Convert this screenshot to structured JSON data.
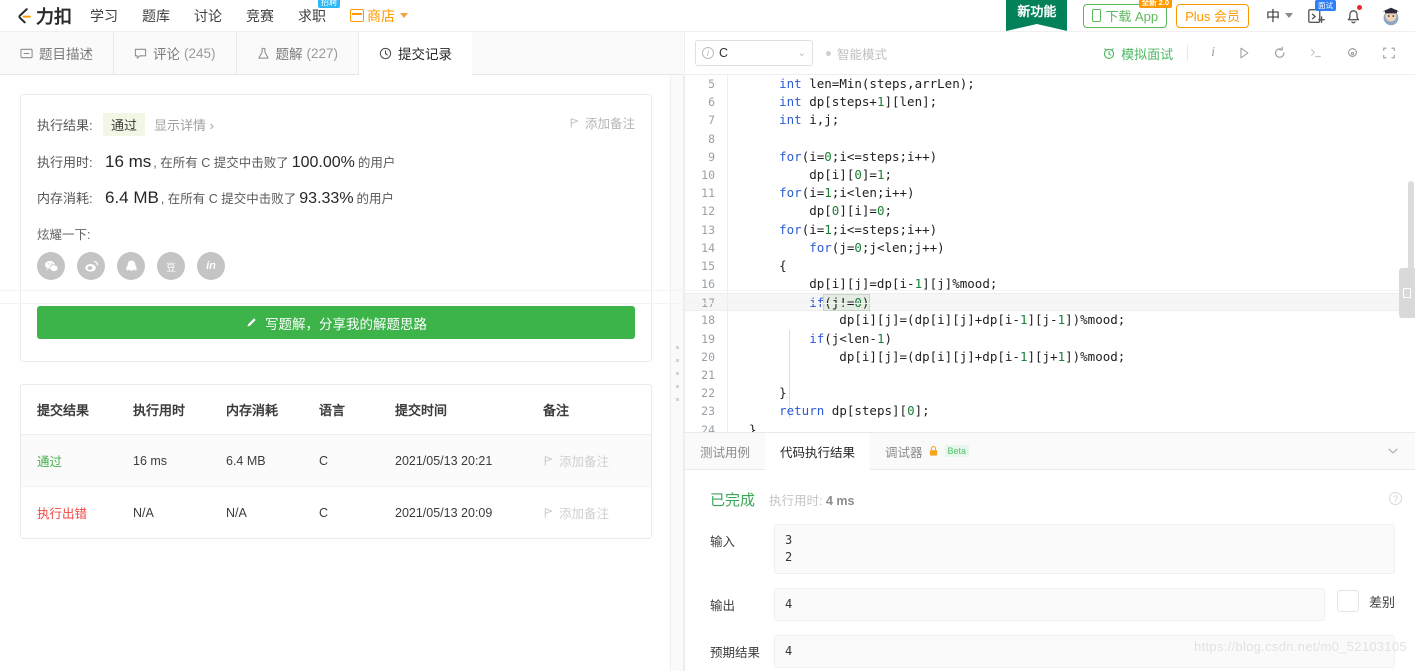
{
  "topnav": {
    "brand": "力扣",
    "links": [
      {
        "label": "学习"
      },
      {
        "label": "题库"
      },
      {
        "label": "讨论"
      },
      {
        "label": "竞赛"
      },
      {
        "label": "求职",
        "badge": "招聘"
      },
      {
        "label": "商店",
        "icon": "store-icon",
        "caret": true
      }
    ],
    "ribbon": "新功能",
    "download_app": "下载 App",
    "download_badge": "全新 2.0",
    "plus_member": "Plus 会员",
    "lang": "中",
    "icons": [
      "interview-card-icon",
      "bell-icon",
      "avatar"
    ],
    "interview_badge": "面试"
  },
  "tabs": [
    {
      "label": "题目描述",
      "icon": "description-icon",
      "count": "",
      "active": false
    },
    {
      "label": "评论",
      "icon": "comment-icon",
      "count": "(245)",
      "active": false
    },
    {
      "label": "题解",
      "icon": "solution-icon",
      "count": "(227)",
      "active": false
    },
    {
      "label": "提交记录",
      "icon": "clock-icon",
      "count": "",
      "active": true
    }
  ],
  "result": {
    "exec_result_label": "执行结果:",
    "status": "通过",
    "show_detail": "显示详情",
    "runtime_label": "执行用时:",
    "runtime_value": "16 ms",
    "runtime_prefix": ", 在所有 C 提交中击败了",
    "runtime_pct": "100.00%",
    "runtime_suffix": "的用户",
    "memory_label": "内存消耗:",
    "memory_value": "6.4 MB",
    "memory_prefix": ", 在所有 C 提交中击败了",
    "memory_pct": "93.33%",
    "memory_suffix": "的用户",
    "add_note": "添加备注",
    "share_label": "炫耀一下:",
    "share_icons": [
      "wechat-icon",
      "weibo-icon",
      "qq-icon",
      "douban-icon",
      "linkedin-icon"
    ],
    "write_solution_btn": "写题解，分享我的解题思路"
  },
  "submissions": {
    "headers": [
      "提交结果",
      "执行用时",
      "内存消耗",
      "语言",
      "提交时间",
      "备注"
    ],
    "rows": [
      {
        "status": "通过",
        "status_type": "pass",
        "runtime": "16 ms",
        "memory": "6.4 MB",
        "language": "C",
        "time": "2021/05/13 20:21",
        "note": "添加备注"
      },
      {
        "status": "执行出错",
        "status_type": "error",
        "runtime": "N/A",
        "memory": "N/A",
        "language": "C",
        "time": "2021/05/13 20:09",
        "note": "添加备注"
      }
    ]
  },
  "editor": {
    "language": "C",
    "smart_mode": "智能模式",
    "mock_interview": "模拟面试",
    "toolbar_icons": [
      "info-icon",
      "run-icon",
      "reset-icon",
      "console-icon",
      "settings-icon",
      "fullscreen-icon"
    ],
    "lines": [
      {
        "n": "5",
        "text": "    int len=Min(steps,arrLen);"
      },
      {
        "n": "6",
        "text": "    int dp[steps+1][len];"
      },
      {
        "n": "7",
        "text": "    int i,j;"
      },
      {
        "n": "8",
        "text": ""
      },
      {
        "n": "9",
        "text": "    for(i=0;i<=steps;i++)"
      },
      {
        "n": "10",
        "text": "        dp[i][0]=1;"
      },
      {
        "n": "11",
        "text": "    for(i=1;i<len;i++)"
      },
      {
        "n": "12",
        "text": "        dp[0][i]=0;"
      },
      {
        "n": "13",
        "text": "    for(i=1;i<=steps;i++)"
      },
      {
        "n": "14",
        "text": "        for(j=0;j<len;j++)"
      },
      {
        "n": "15",
        "text": "    {"
      },
      {
        "n": "16",
        "text": "        dp[i][j]=dp[i-1][j]%mood;"
      },
      {
        "n": "17",
        "text": "        if(j!=0)"
      },
      {
        "n": "18",
        "text": "            dp[i][j]=(dp[i][j]+dp[i-1][j-1])%mood;"
      },
      {
        "n": "19",
        "text": "        if(j<len-1)"
      },
      {
        "n": "20",
        "text": "            dp[i][j]=(dp[i][j]+dp[i-1][j+1])%mood;"
      },
      {
        "n": "21",
        "text": ""
      },
      {
        "n": "22",
        "text": "    }"
      },
      {
        "n": "23",
        "text": "    return dp[steps][0];"
      },
      {
        "n": "24",
        "text": "}"
      }
    ]
  },
  "console": {
    "tabs": [
      {
        "label": "测试用例",
        "active": false
      },
      {
        "label": "代码执行结果",
        "active": true
      },
      {
        "label": "调试器",
        "active": false,
        "lock": true,
        "beta": "Beta"
      }
    ],
    "status": "已完成",
    "runtime_label": "执行用时:",
    "runtime_value": "4 ms",
    "io": [
      {
        "label": "输入",
        "value": "3\n2"
      },
      {
        "label": "输出",
        "value": "4"
      },
      {
        "label": "预期结果",
        "value": "4"
      }
    ],
    "diff_label": "差别"
  },
  "watermark": "https://blog.csdn.net/m0_52103105",
  "colors": {
    "green": "#3cb44a",
    "orange": "#f90",
    "pass": "#45ad4d",
    "error": "#ef4743",
    "blue": "#2d7ff9"
  }
}
